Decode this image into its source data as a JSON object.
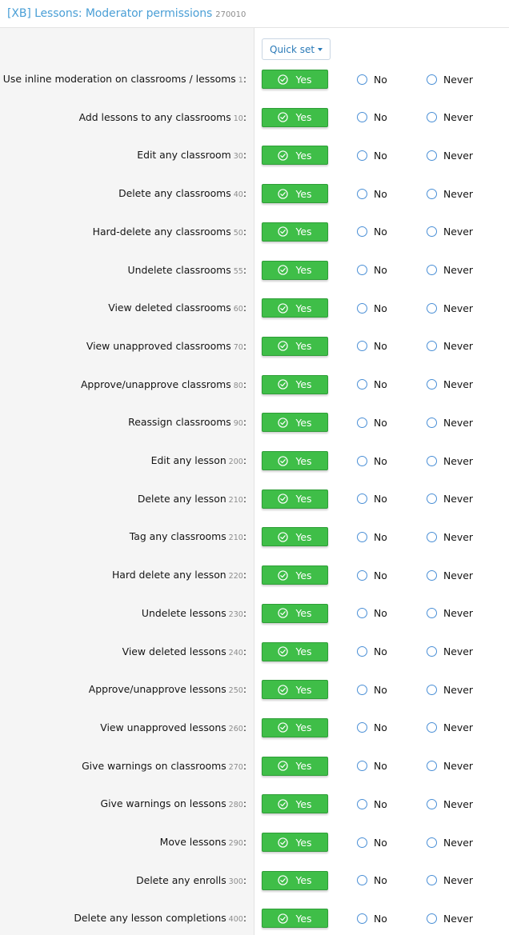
{
  "header": {
    "title": "[XB] Lessons: Moderator permissions",
    "group_id": "270010"
  },
  "quick_set": {
    "label": "Quick set"
  },
  "options": {
    "yes": "Yes",
    "no": "No",
    "never": "Never"
  },
  "colors": {
    "title": "#4a9fd6",
    "yes_green": "#3fbe48",
    "radio_blue": "#4a8fd6",
    "label_bg": "#f5f5f5"
  },
  "permissions": [
    {
      "label": "Use inline moderation on classrooms / lessoms",
      "id": "1",
      "value": "Yes"
    },
    {
      "label": "Add lessons to any classrooms",
      "id": "10",
      "value": "Yes"
    },
    {
      "label": "Edit any classroom",
      "id": "30",
      "value": "Yes"
    },
    {
      "label": "Delete any classrooms",
      "id": "40",
      "value": "Yes"
    },
    {
      "label": "Hard-delete any classrooms",
      "id": "50",
      "value": "Yes"
    },
    {
      "label": "Undelete classrooms",
      "id": "55",
      "value": "Yes"
    },
    {
      "label": "View deleted classrooms",
      "id": "60",
      "value": "Yes"
    },
    {
      "label": "View unapproved classrooms",
      "id": "70",
      "value": "Yes"
    },
    {
      "label": "Approve/unapprove classroms",
      "id": "80",
      "value": "Yes"
    },
    {
      "label": "Reassign classrooms",
      "id": "90",
      "value": "Yes"
    },
    {
      "label": "Edit any lesson",
      "id": "200",
      "value": "Yes"
    },
    {
      "label": "Delete any lesson",
      "id": "210",
      "value": "Yes"
    },
    {
      "label": "Tag any classrooms",
      "id": "210",
      "value": "Yes"
    },
    {
      "label": "Hard delete any lesson",
      "id": "220",
      "value": "Yes"
    },
    {
      "label": "Undelete lessons",
      "id": "230",
      "value": "Yes"
    },
    {
      "label": "View deleted lessons",
      "id": "240",
      "value": "Yes"
    },
    {
      "label": "Approve/unapprove lessons",
      "id": "250",
      "value": "Yes"
    },
    {
      "label": "View unapproved lessons",
      "id": "260",
      "value": "Yes"
    },
    {
      "label": "Give warnings on classrooms",
      "id": "270",
      "value": "Yes"
    },
    {
      "label": "Give warnings on lessons",
      "id": "280",
      "value": "Yes"
    },
    {
      "label": "Move lessons",
      "id": "290",
      "value": "Yes"
    },
    {
      "label": "Delete any enrolls",
      "id": "300",
      "value": "Yes"
    },
    {
      "label": "Delete any lesson completions",
      "id": "400",
      "value": "Yes"
    }
  ]
}
